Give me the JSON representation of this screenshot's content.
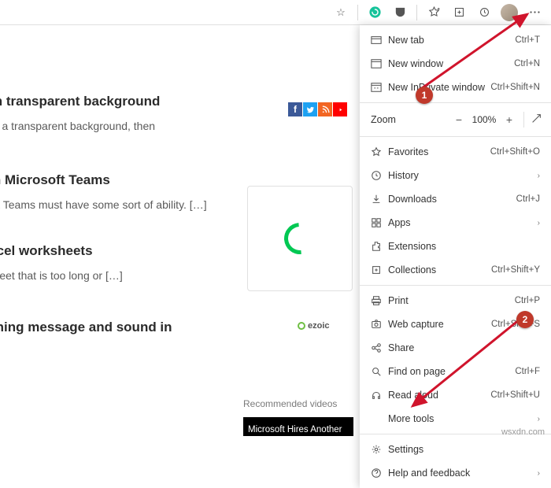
{
  "toolbar": {
    "extensions": [
      "grammarly",
      "ublock"
    ],
    "star": "☆"
  },
  "articles": [
    {
      "title": "s with transparent background",
      "excerpt": "es with a transparent background, then"
    },
    {
      "title": "on on Microsoft Teams",
      "excerpt": "icrosoft Teams must have some sort of ability. […]"
    },
    {
      "title": "in Excel worksheets",
      "excerpt": "worksheet that is too long or […]"
    },
    {
      "title": "t warning message and sound in",
      "excerpt": ""
    }
  ],
  "ezoic": "ezoic",
  "recommended": {
    "label": "Recommended videos",
    "tile": "Microsoft Hires Another"
  },
  "menu": {
    "newtab": {
      "label": "New tab",
      "shortcut": "Ctrl+T"
    },
    "newwin": {
      "label": "New window",
      "shortcut": "Ctrl+N"
    },
    "inprivate": {
      "label": "New InPrivate window",
      "shortcut": "Ctrl+Shift+N"
    },
    "zoom": {
      "label": "Zoom",
      "value": "100%"
    },
    "favorites": {
      "label": "Favorites",
      "shortcut": "Ctrl+Shift+O"
    },
    "history": {
      "label": "History"
    },
    "downloads": {
      "label": "Downloads",
      "shortcut": "Ctrl+J"
    },
    "apps": {
      "label": "Apps"
    },
    "extensions": {
      "label": "Extensions"
    },
    "collections": {
      "label": "Collections",
      "shortcut": "Ctrl+Shift+Y"
    },
    "print": {
      "label": "Print",
      "shortcut": "Ctrl+P"
    },
    "webcapture": {
      "label": "Web capture",
      "shortcut": "Ctrl+Shift+S"
    },
    "share": {
      "label": "Share"
    },
    "findonpage": {
      "label": "Find on page",
      "shortcut": "Ctrl+F"
    },
    "readaloud": {
      "label": "Read aloud",
      "shortcut": "Ctrl+Shift+U"
    },
    "moretools": {
      "label": "More tools"
    },
    "settings": {
      "label": "Settings"
    },
    "help": {
      "label": "Help and feedback"
    }
  },
  "badges": {
    "one": "1",
    "two": "2"
  },
  "watermark": "wsxdn.com"
}
